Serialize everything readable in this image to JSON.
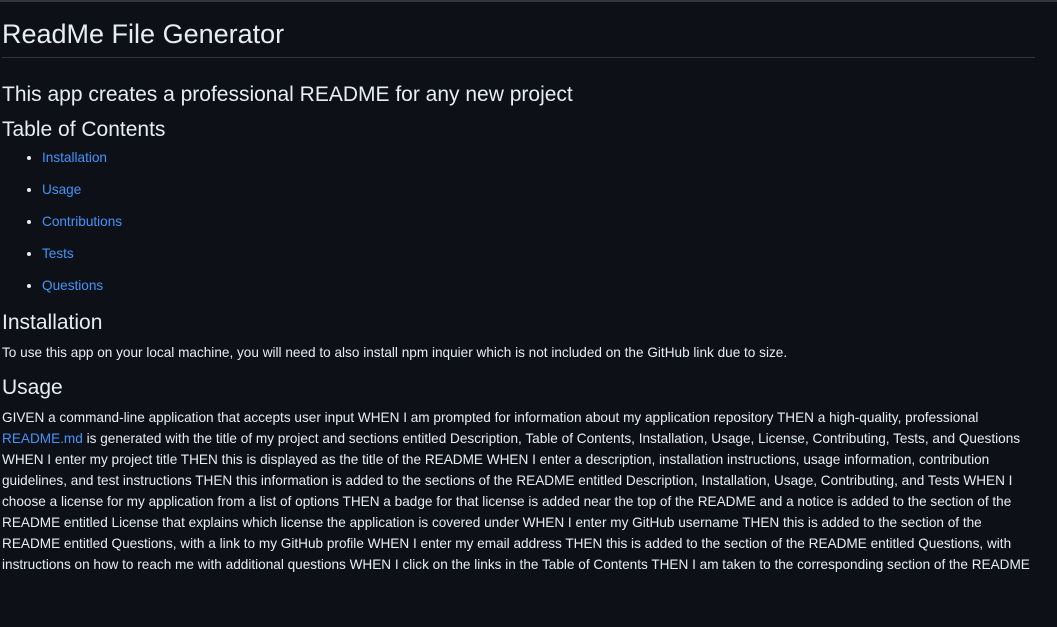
{
  "title": "ReadMe File Generator",
  "subtitle": "This app creates a professional README for any new project",
  "toc": {
    "heading": "Table of Contents",
    "items": [
      {
        "label": "Installation"
      },
      {
        "label": "Usage"
      },
      {
        "label": "Contributions"
      },
      {
        "label": "Tests"
      },
      {
        "label": "Questions"
      }
    ]
  },
  "installation": {
    "heading": "Installation",
    "text": "To use this app on your local machine, you will need to also install npm inquier which is not included on the GitHub link due to size."
  },
  "usage": {
    "heading": "Usage",
    "text_before_link": "GIVEN a command-line application that accepts user input WHEN I am prompted for information about my application repository THEN a high-quality, professional ",
    "link_text": "README.md",
    "text_after_link": " is generated with the title of my project and sections entitled Description, Table of Contents, Installation, Usage, License, Contributing, Tests, and Questions WHEN I enter my project title THEN this is displayed as the title of the README WHEN I enter a description, installation instructions, usage information, contribution guidelines, and test instructions THEN this information is added to the sections of the README entitled Description, Installation, Usage, Contributing, and Tests WHEN I choose a license for my application from a list of options THEN a badge for that license is added near the top of the README and a notice is added to the section of the README entitled License that explains which license the application is covered under WHEN I enter my GitHub username THEN this is added to the section of the README entitled Questions, with a link to my GitHub profile WHEN I enter my email address THEN this is added to the section of the README entitled Questions, with instructions on how to reach me with additional questions WHEN I click on the links in the Table of Contents THEN I am taken to the corresponding section of the README"
  },
  "colors": {
    "background": "#0d1117",
    "text": "#e6edf3",
    "link": "#4493f8",
    "divider": "#30363d"
  }
}
